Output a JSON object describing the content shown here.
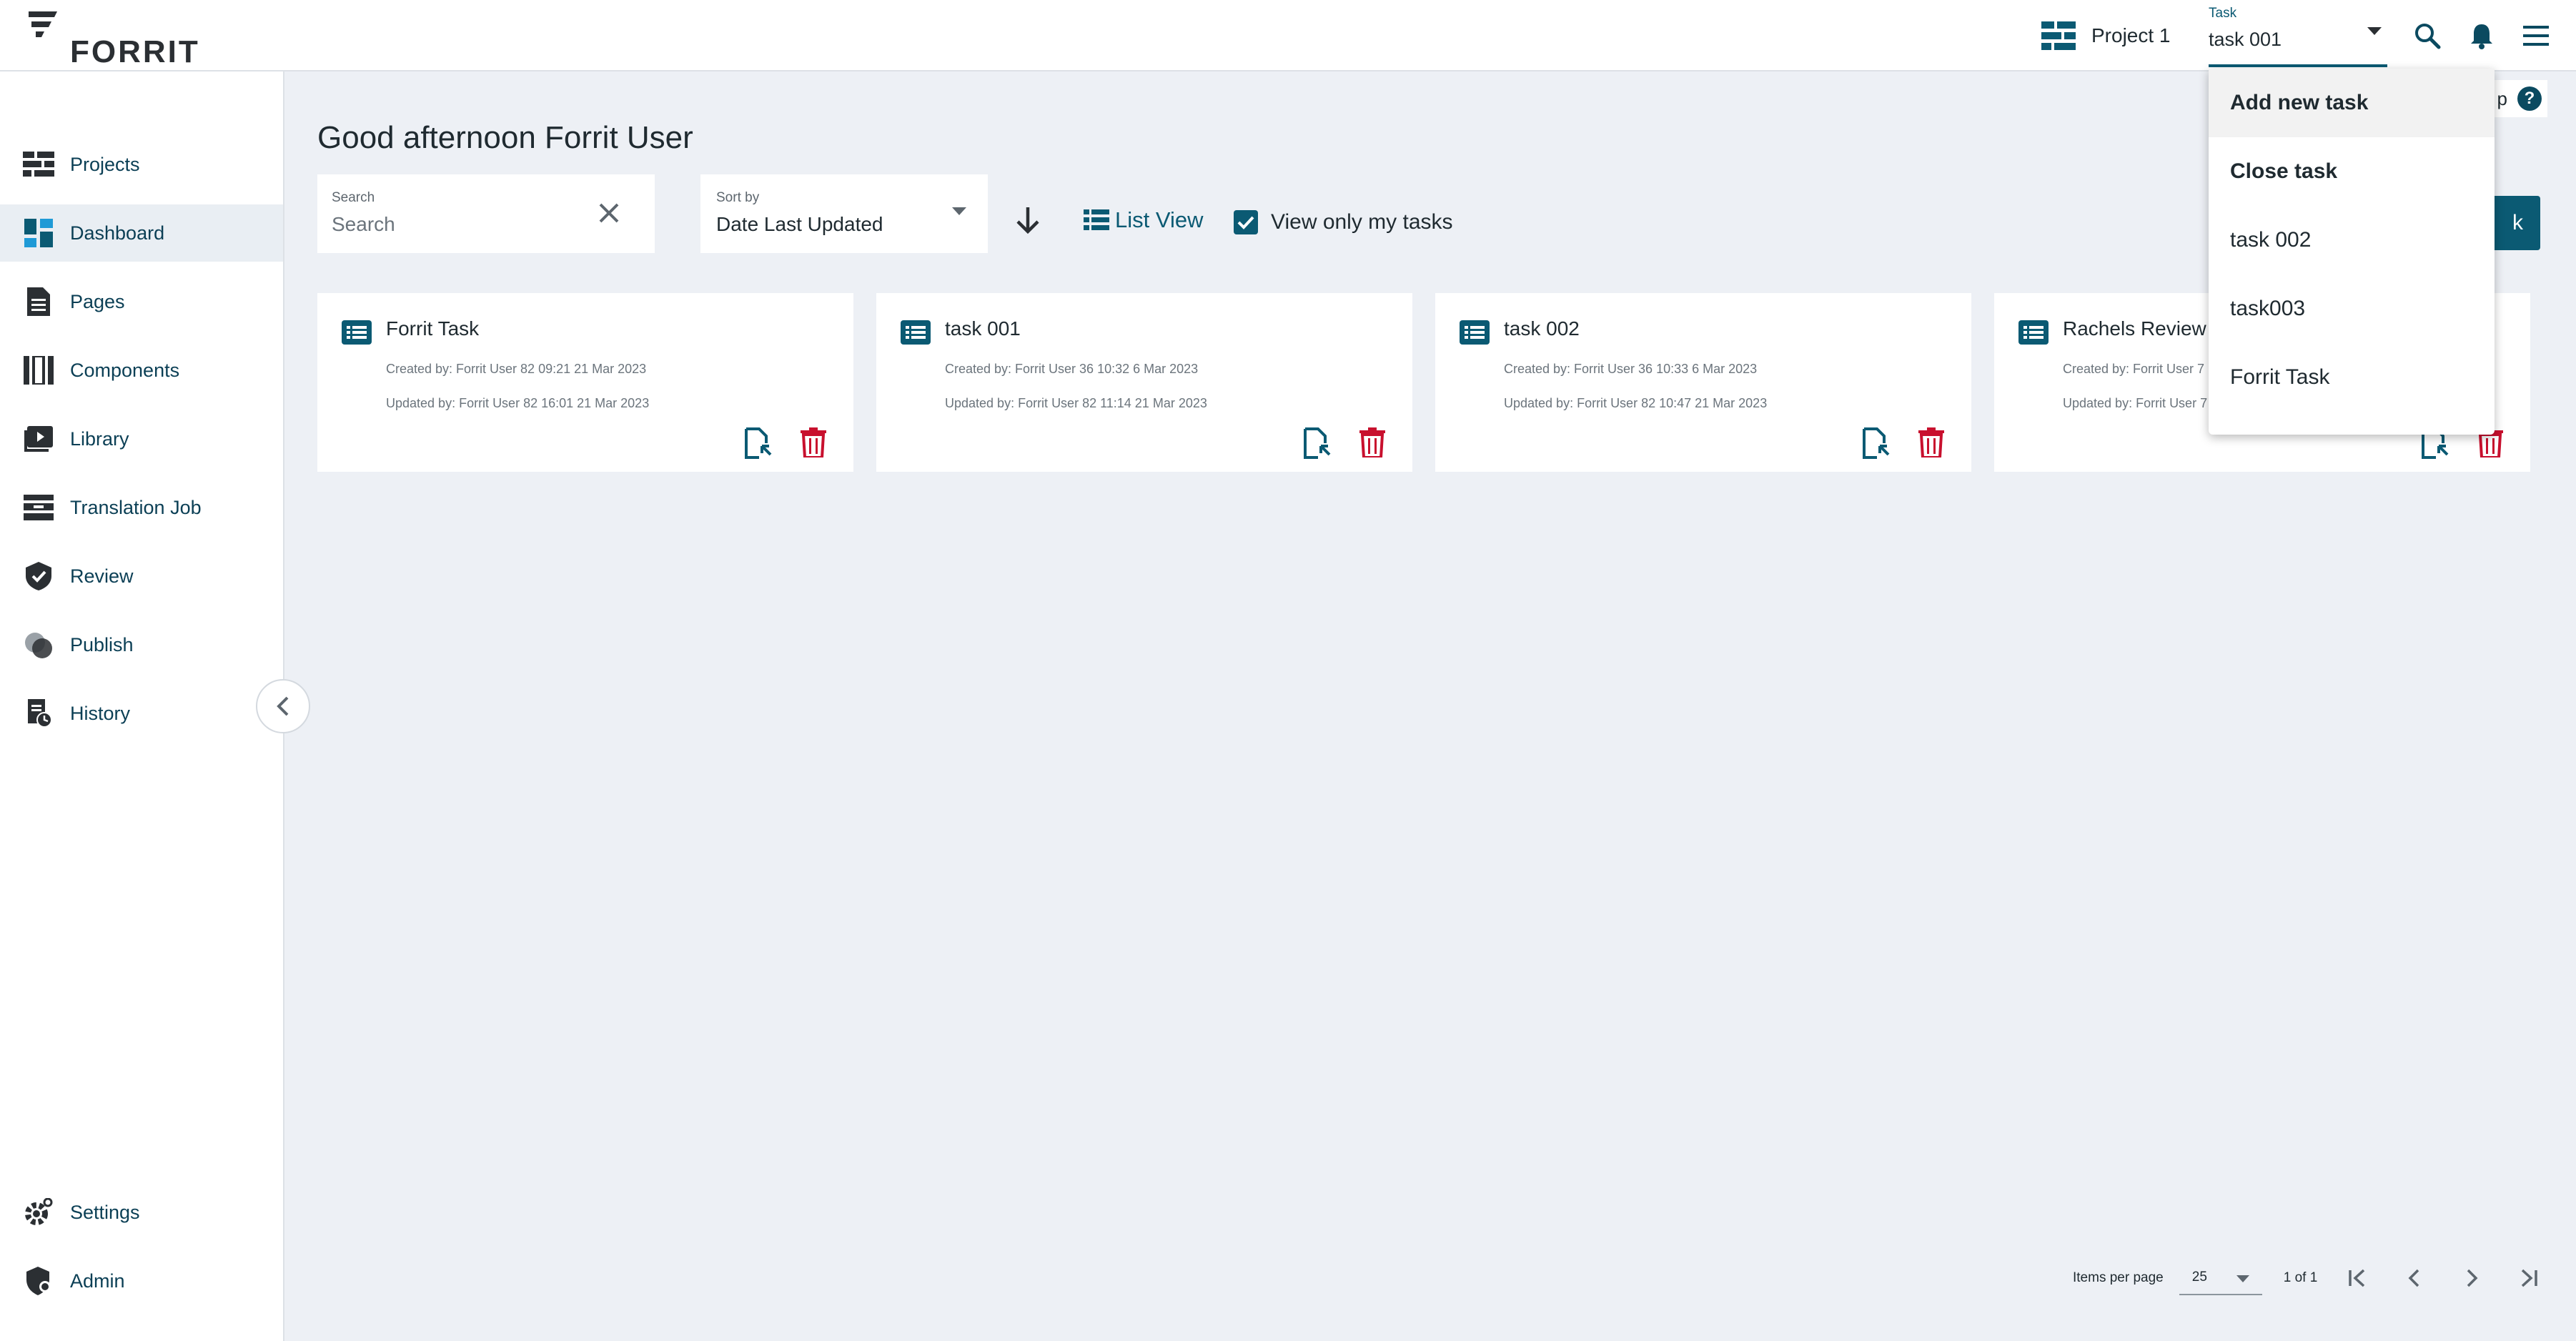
{
  "colors": {
    "accent": "#0b5a73",
    "danger": "#c8102e",
    "nav_text": "#0b3f55",
    "background": "#edf0f5"
  },
  "header": {
    "logo_text": "FORRIT",
    "project_label": "Project 1",
    "task_field_label": "Task",
    "task_field_value": "task 001",
    "icons": [
      "search-icon",
      "bell-icon",
      "hamburger-menu-icon"
    ]
  },
  "sidebar": {
    "items": [
      {
        "label": "Projects",
        "icon": "projects-icon"
      },
      {
        "label": "Dashboard",
        "icon": "dashboard-icon",
        "active": true
      },
      {
        "label": "Pages",
        "icon": "pages-icon"
      },
      {
        "label": "Components",
        "icon": "components-icon"
      },
      {
        "label": "Library",
        "icon": "library-icon"
      },
      {
        "label": "Translation Job",
        "icon": "translation-job-icon"
      },
      {
        "label": "Review",
        "icon": "review-icon"
      },
      {
        "label": "Publish",
        "icon": "publish-icon"
      },
      {
        "label": "History",
        "icon": "history-icon"
      }
    ],
    "bottom_items": [
      {
        "label": "Settings",
        "icon": "settings-icon"
      },
      {
        "label": "Admin",
        "icon": "admin-icon"
      }
    ]
  },
  "main": {
    "greeting": "Good afternoon Forrit User",
    "search": {
      "label": "Search",
      "placeholder": "Search"
    },
    "sort": {
      "label": "Sort by",
      "value": "Date Last Updated"
    },
    "list_view_label": "List View",
    "my_tasks_label": "View only my tasks",
    "my_tasks_checked": true,
    "add_button_label": "k",
    "help_label": "p"
  },
  "cards": [
    {
      "title": "Forrit Task",
      "created": "Created by: Forrit User 82 09:21 21 Mar 2023",
      "updated": "Updated by: Forrit User 82 16:01 21 Mar 2023"
    },
    {
      "title": "task 001",
      "created": "Created by: Forrit User 36 10:32 6 Mar 2023",
      "updated": "Updated by: Forrit User 82 11:14 21 Mar 2023"
    },
    {
      "title": "task 002",
      "created": "Created by: Forrit User 36 10:33 6 Mar 2023",
      "updated": "Updated by: Forrit User 82 10:47 21 Mar 2023"
    },
    {
      "title": "Rachels Review",
      "created": "Created by: Forrit User 7",
      "updated": "Updated by: Forrit User 7"
    }
  ],
  "pagination": {
    "items_per_page_label": "Items per page",
    "items_per_page_value": "25",
    "range": "1 of 1"
  },
  "task_dropdown": {
    "items": [
      {
        "label": "Add new task",
        "bold": true
      },
      {
        "label": "Close task",
        "bold": true
      },
      {
        "label": "task 002",
        "bold": false
      },
      {
        "label": "task003",
        "bold": false
      },
      {
        "label": "Forrit Task",
        "bold": false
      }
    ]
  }
}
